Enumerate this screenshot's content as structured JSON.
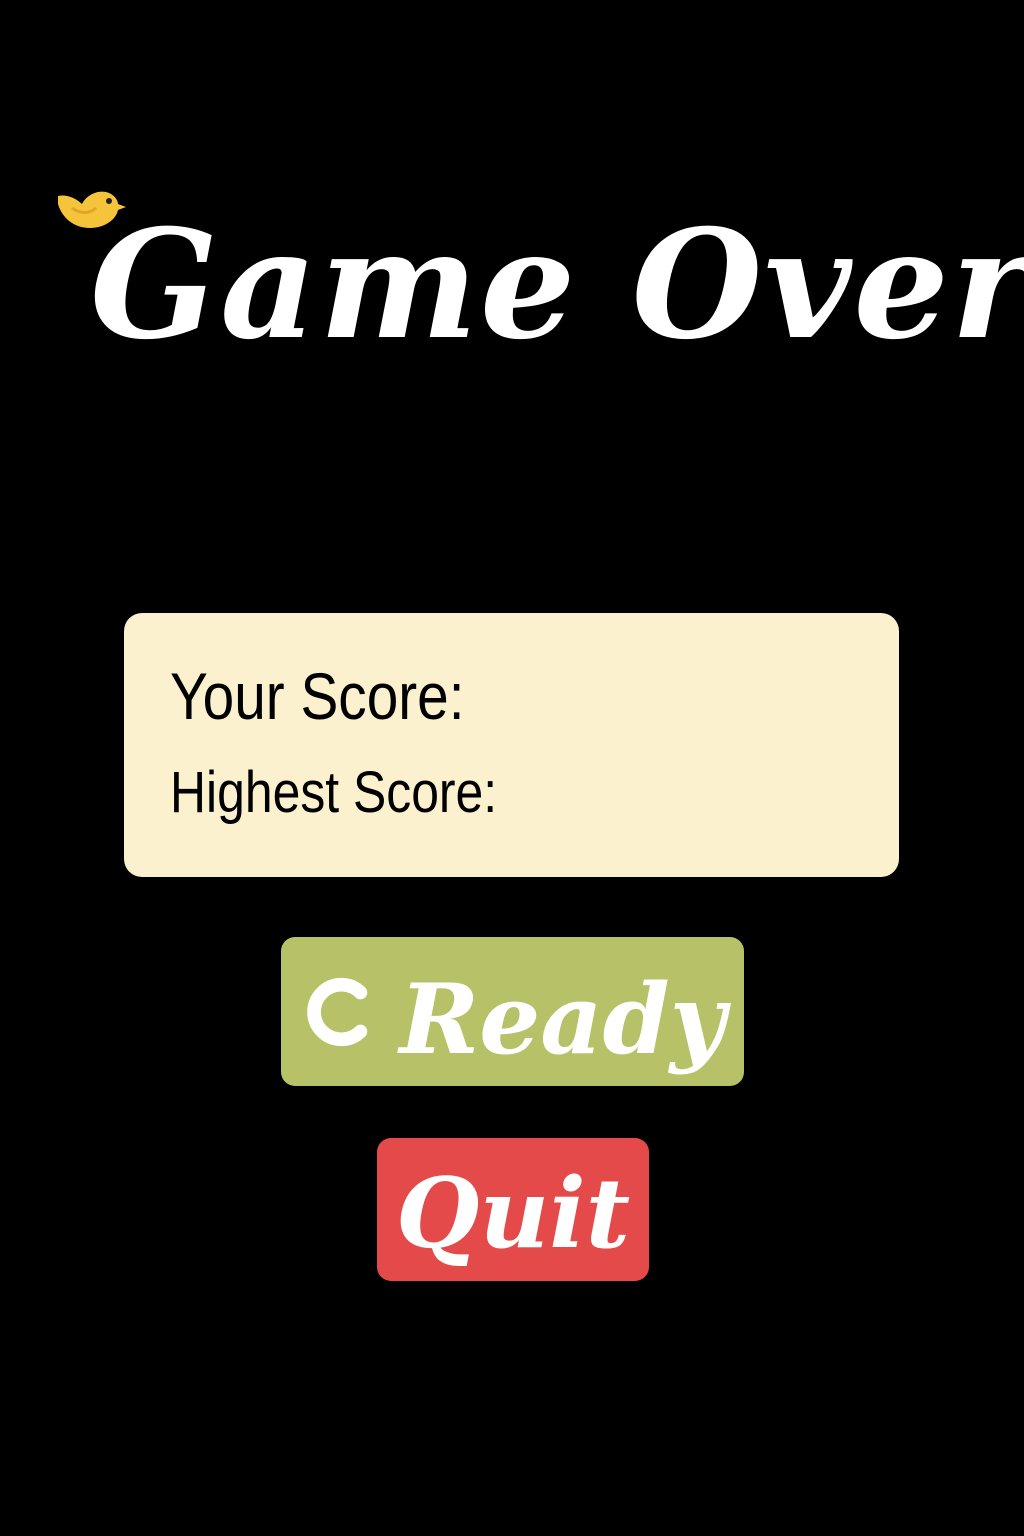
{
  "title": "Game Over",
  "scores": {
    "your_score_label": "Your Score:",
    "highest_score_label": "Highest Score:"
  },
  "buttons": {
    "ready_label": "Ready",
    "ready_icon": "retry-icon",
    "quit_label": "Quit"
  },
  "icons": {
    "mascot": "bird-icon"
  },
  "colors": {
    "background": "#000000",
    "title": "#ffffff",
    "panel": "#fcf1cf",
    "ready_button": "#b7c168",
    "quit_button": "#e54a4b",
    "bird": "#f6c43a"
  }
}
